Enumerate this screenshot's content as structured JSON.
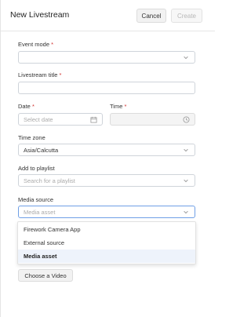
{
  "header": {
    "title": "New Livestream",
    "cancel_label": "Cancel",
    "create_label": "Create"
  },
  "form": {
    "event_mode": {
      "label": "Event mode",
      "required_mark": "*",
      "value": ""
    },
    "livestream_title": {
      "label": "Livestream title",
      "required_mark": "*",
      "value": ""
    },
    "date": {
      "label": "Date",
      "required_mark": "*",
      "placeholder": "Select date"
    },
    "time": {
      "label": "Time",
      "required_mark": "*",
      "value": ""
    },
    "time_zone": {
      "label": "Time zone",
      "value": "Asia/Calcutta"
    },
    "playlist": {
      "label": "Add to playlist",
      "placeholder": "Search for a playlist"
    },
    "media_source": {
      "label": "Media source",
      "value": "Media asset"
    }
  },
  "dropdown": {
    "options": [
      "Firework Camera App",
      "External source",
      "Media asset"
    ],
    "selected_index": 2
  },
  "choose_video_label": "Choose a Video",
  "colors": {
    "required": "#d0302e",
    "active_border": "#6f9fe6",
    "selected_bg": "#eef3fb"
  }
}
